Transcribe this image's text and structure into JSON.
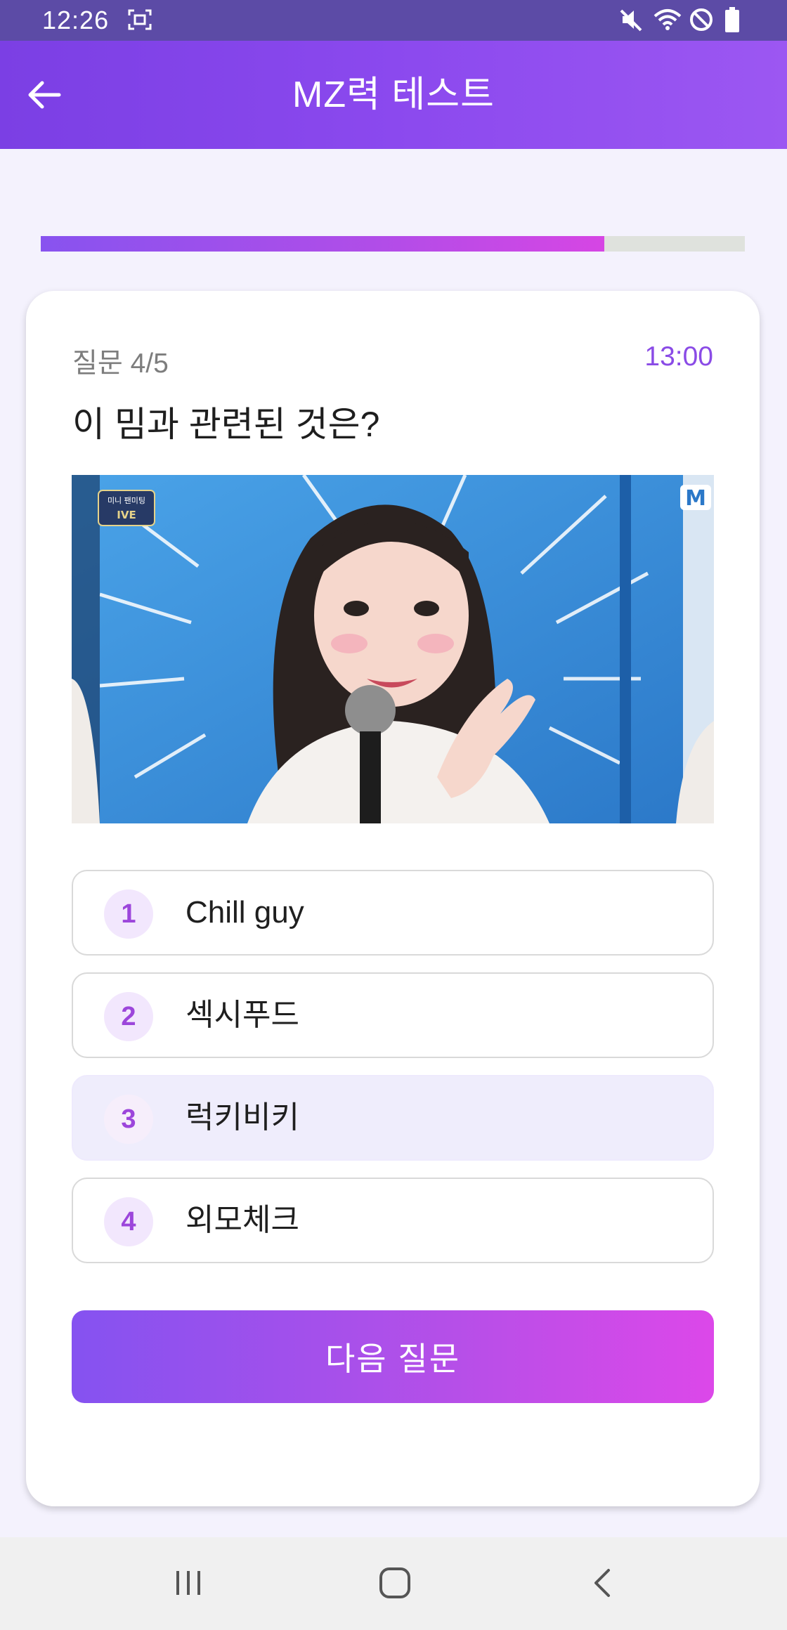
{
  "status_bar": {
    "time": "12:26",
    "icons": [
      "screenshot-icon",
      "mute-icon",
      "wifi-icon",
      "do-not-disturb-icon",
      "battery-icon"
    ]
  },
  "header": {
    "title": "MZ력 테스트",
    "back_icon": "back-arrow-icon"
  },
  "progress": {
    "value": 0.8
  },
  "question": {
    "counter": "질문 4/5",
    "timer": "13:00",
    "text": "이 밈과 관련된 것은?",
    "image": {
      "description_icon": "meme-photo",
      "badge_top": "미니 팬미팅",
      "badge_bottom": "IVE",
      "channel_logo": "M"
    }
  },
  "options": [
    {
      "number": "1",
      "label": "Chill guy",
      "selected": false
    },
    {
      "number": "2",
      "label": "섹시푸드",
      "selected": false
    },
    {
      "number": "3",
      "label": "럭키비키",
      "selected": true
    },
    {
      "number": "4",
      "label": "외모체크",
      "selected": false
    }
  ],
  "actions": {
    "next_label": "다음 질문"
  },
  "nav_bar": {
    "icons": [
      "recent-apps-icon",
      "home-icon",
      "back-icon"
    ]
  },
  "colors": {
    "accent": "#8a4be6",
    "header_start": "#7b3fe4",
    "header_end": "#9c57f2",
    "button_end": "#dc48e9",
    "status_bar": "#5c4ba6"
  }
}
